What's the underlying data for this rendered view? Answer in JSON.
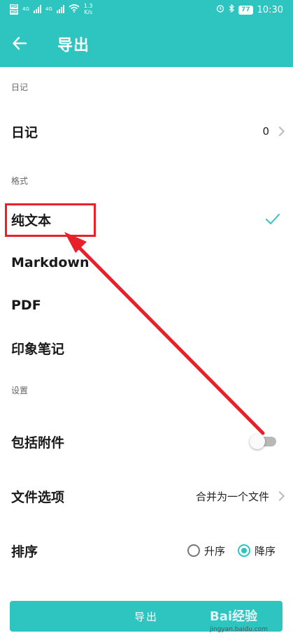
{
  "status_bar": {
    "sim1": "HD",
    "sim2": "HD",
    "net1": "4G",
    "net2": "4G",
    "speed_value": "1.3",
    "speed_unit": "K/s",
    "battery": "77",
    "time": "10:30"
  },
  "header": {
    "title": "导出"
  },
  "sections": {
    "diary": "日记",
    "format": "格式",
    "settings": "设置"
  },
  "diary_row": {
    "label": "日记",
    "value": "0"
  },
  "formats": [
    {
      "label": "纯文本",
      "selected": true
    },
    {
      "label": "Markdown"
    },
    {
      "label": "PDF"
    },
    {
      "label": "印象笔记"
    }
  ],
  "settings": {
    "include_attachments": {
      "label": "包括附件",
      "on": false
    },
    "file_options": {
      "label": "文件选项",
      "value": "合并为一个文件"
    },
    "sort": {
      "label": "排序",
      "asc": "升序",
      "desc": "降序",
      "selected": "desc"
    }
  },
  "export_button": "导出",
  "watermark": {
    "brand": "Bai经验",
    "url": "jingyan.baidu.com"
  },
  "colors": {
    "accent": "#2ec4c0",
    "annotation": "#e8202a"
  }
}
